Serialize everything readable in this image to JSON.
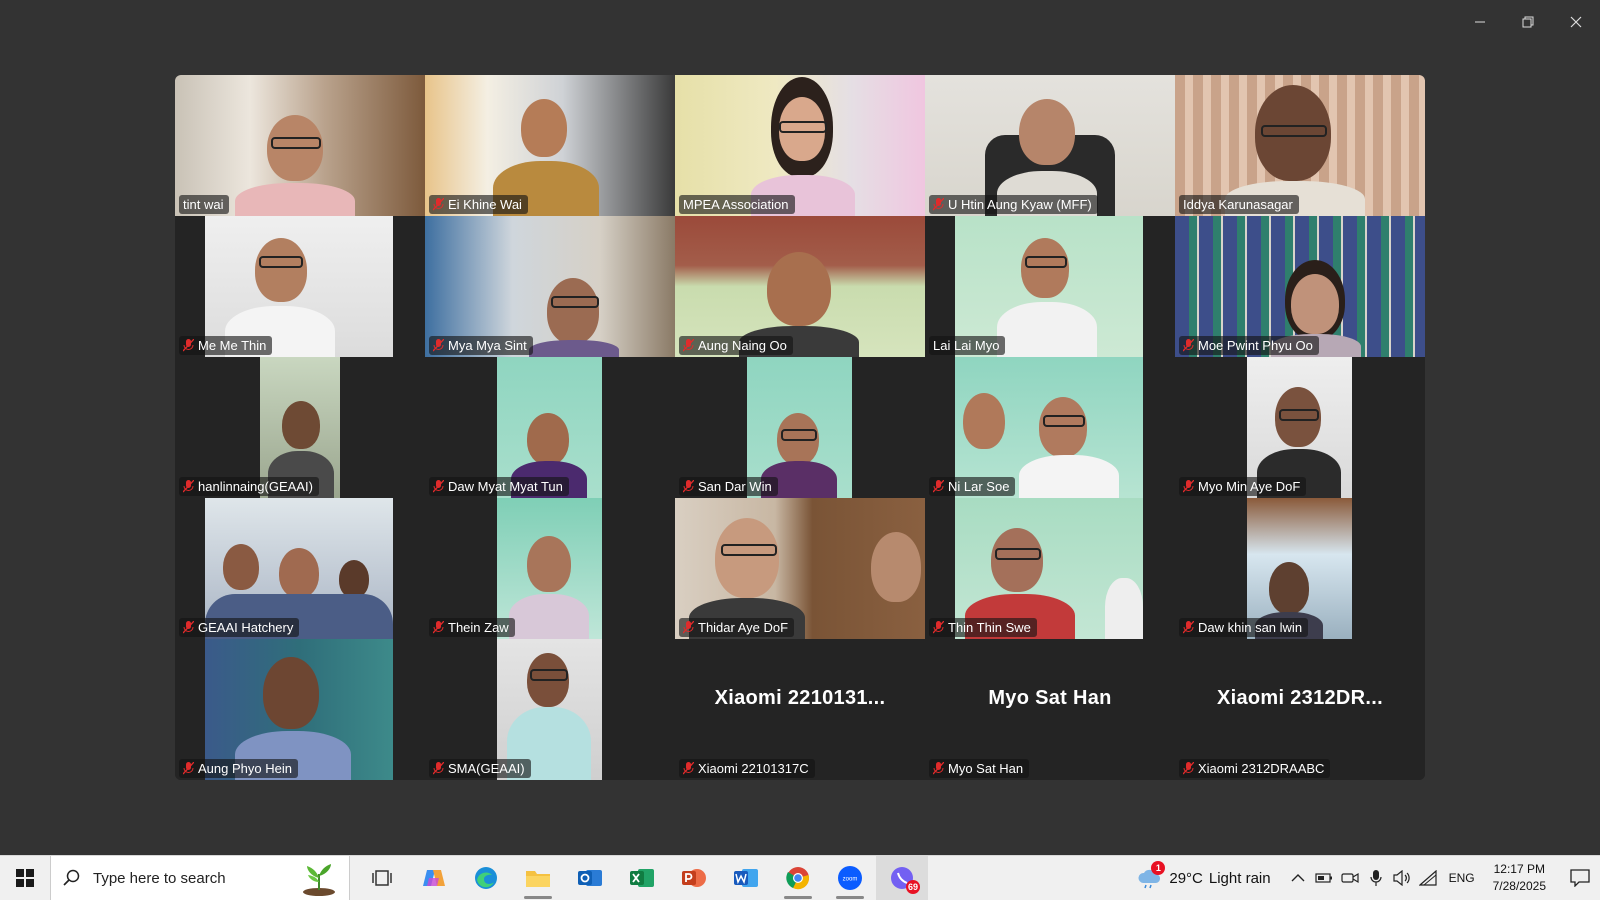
{
  "participants": [
    {
      "name": "tint wai",
      "muted": false,
      "video": true
    },
    {
      "name": "Ei Khine Wai",
      "muted": true,
      "video": true
    },
    {
      "name": "MPEA Association",
      "muted": false,
      "video": true,
      "active_speaker": true
    },
    {
      "name": "U Htin Aung Kyaw (MFF)",
      "muted": true,
      "video": true
    },
    {
      "name": "Iddya Karunasagar",
      "muted": false,
      "video": true
    },
    {
      "name": "Me Me Thin",
      "muted": true,
      "video": true
    },
    {
      "name": "Mya Mya Sint",
      "muted": true,
      "video": true
    },
    {
      "name": "Aung Naing Oo",
      "muted": true,
      "video": true
    },
    {
      "name": "Lai Lai Myo",
      "muted": false,
      "video": true
    },
    {
      "name": "Moe Pwint Phyu Oo",
      "muted": true,
      "video": true
    },
    {
      "name": "hanlinnaing(GEAAI)",
      "muted": true,
      "video": true
    },
    {
      "name": "Daw Myat Myat Tun",
      "muted": true,
      "video": true
    },
    {
      "name": "San Dar Win",
      "muted": true,
      "video": true
    },
    {
      "name": "Ni Lar Soe",
      "muted": true,
      "video": true
    },
    {
      "name": "Myo Min Aye DoF",
      "muted": true,
      "video": true
    },
    {
      "name": "GEAAI Hatchery",
      "muted": true,
      "video": true
    },
    {
      "name": "Thein Zaw",
      "muted": true,
      "video": true
    },
    {
      "name": "Thidar Aye DoF",
      "muted": true,
      "video": true
    },
    {
      "name": "Thin Thin Swe",
      "muted": true,
      "video": true
    },
    {
      "name": "Daw khin san lwin",
      "muted": true,
      "video": true
    },
    {
      "name": "Aung Phyo Hein",
      "muted": true,
      "video": true
    },
    {
      "name": "SMA(GEAAI)",
      "muted": true,
      "video": true
    },
    {
      "name": "Xiaomi 22101317C",
      "display": "Xiaomi  2210131...",
      "muted": true,
      "video": false
    },
    {
      "name": "Myo Sat Han",
      "display": "Myo Sat Han",
      "muted": true,
      "video": false
    },
    {
      "name": "Xiaomi 2312DRAABC",
      "display": "Xiaomi  2312DR...",
      "muted": true,
      "video": false
    }
  ],
  "taskbar": {
    "search_placeholder": "Type here to search",
    "apps": [
      "task-view",
      "copilot",
      "edge",
      "file-explorer",
      "outlook",
      "excel",
      "powerpoint",
      "word",
      "chrome",
      "zoom",
      "viber"
    ],
    "viber_badge": "69",
    "weather": {
      "badge": "1",
      "temp": "29°C",
      "condition": "Light rain"
    },
    "language": "ENG",
    "time": "12:17 PM",
    "date": "7/28/2025"
  },
  "colors": {
    "active_speaker": "#2ecc71",
    "background": "#333333",
    "gallery": "#242424",
    "mute": "#e02b2b"
  }
}
